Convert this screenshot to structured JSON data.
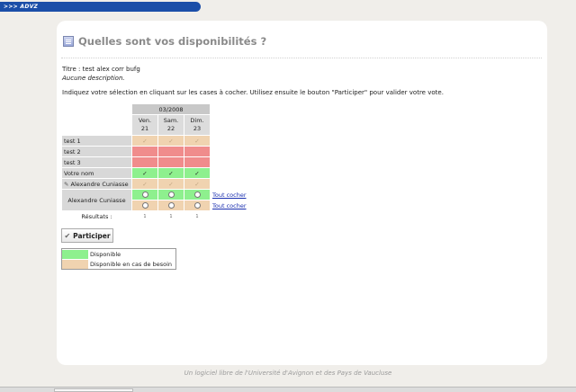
{
  "topbar": {
    "label": ">>> ADVZ"
  },
  "page": {
    "title": "Quelles sont vos disponibilités ?"
  },
  "poll": {
    "title_line": "Titre : test alex corr bufg",
    "description": "Aucune description.",
    "instructions": "Indiquez votre sélection en cliquant sur les cases à cocher. Utilisez ensuite le bouton \"Participer\" pour valider votre vote."
  },
  "grid": {
    "month": "03/2008",
    "days": [
      {
        "name": "Ven.",
        "num": "21"
      },
      {
        "name": "Sam.",
        "num": "22"
      },
      {
        "name": "Dim.",
        "num": "23"
      }
    ],
    "rows": {
      "test1": "test 1",
      "test2": "test 2",
      "test3": "test 3",
      "votre_nom": "Votre nom",
      "alex1": "Alexandre Cuniasse",
      "alex2": "Alexandre Cuniasse"
    },
    "check_all_1": "Tout cocher",
    "check_all_2": "Tout cocher",
    "results_label": "Résultats :",
    "results": [
      "1",
      "1",
      "1"
    ],
    "check_mark": "✓"
  },
  "button": {
    "label": "Participer"
  },
  "legend": {
    "available": "Disponible",
    "if_needed": "Disponible en cas de besoin",
    "available_color": "#8ef08e",
    "if_needed_color": "#f0d3b0"
  },
  "footer": {
    "text": "Un logiciel libre de l'Université d'Avignon et des Pays de Vaucluse"
  }
}
